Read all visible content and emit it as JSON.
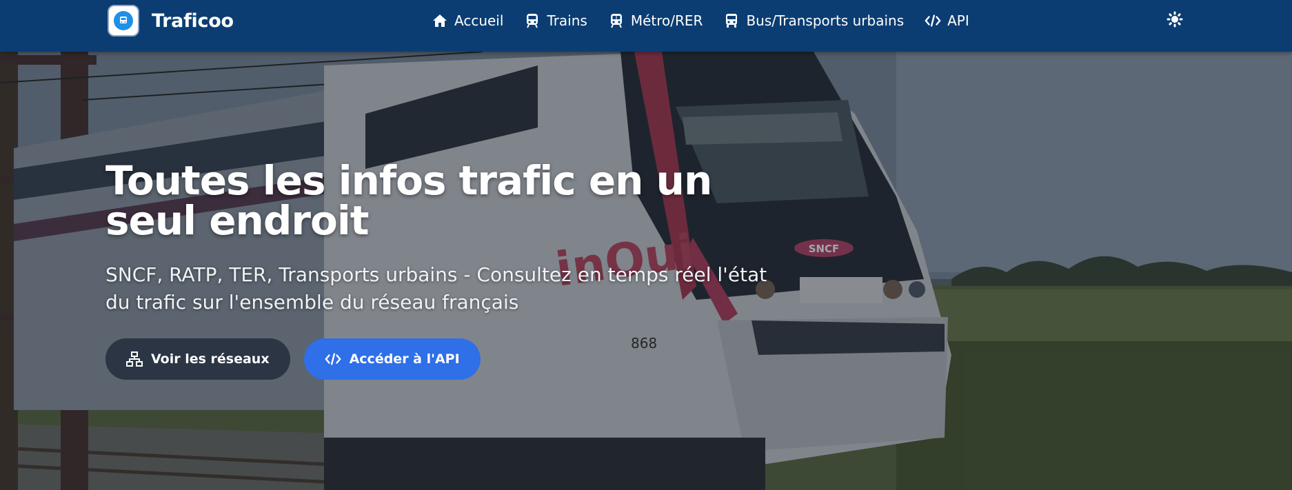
{
  "brand": {
    "name": "Traficoo",
    "logo_icon": "bus-logo-icon"
  },
  "nav": {
    "items": [
      {
        "label": "Accueil",
        "icon": "home-icon"
      },
      {
        "label": "Trains",
        "icon": "train-icon"
      },
      {
        "label": "Métro/RER",
        "icon": "metro-icon"
      },
      {
        "label": "Bus/Transports urbains",
        "icon": "bus-icon"
      },
      {
        "label": "API",
        "icon": "code-icon"
      }
    ],
    "theme_toggle_icon": "sun-icon"
  },
  "hero": {
    "title": "Toutes les infos trafic en un seul endroit",
    "subtitle": "SNCF, RATP, TER, Transports urbains - Consultez en temps réel l'état du trafic sur l'ensemble du réseau français",
    "buttons": [
      {
        "label": "Voir les réseaux",
        "icon": "network-icon"
      },
      {
        "label": "Accéder à l'API",
        "icon": "code-icon"
      }
    ],
    "train_markings": {
      "operator": "SNCF",
      "brand": "inOui",
      "number": "868"
    }
  },
  "colors": {
    "navbar": "#0b3d73",
    "button_primary": "#2f6fe8",
    "button_secondary": "#2b3544",
    "text": "#ffffff"
  }
}
